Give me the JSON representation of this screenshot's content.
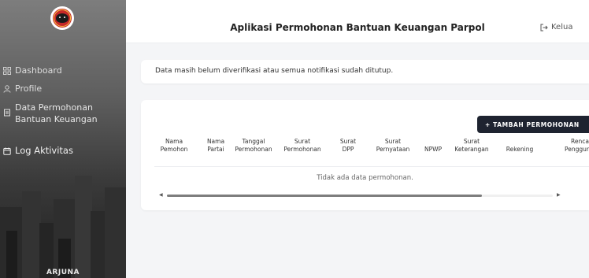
{
  "sidebar": {
    "items": [
      {
        "label": "Dashboard",
        "icon": "grid-icon"
      },
      {
        "label": "Profile",
        "icon": "user-icon"
      },
      {
        "label": "Data Permohonan",
        "label2": "Bantuan Keuangan",
        "icon": "document-icon"
      },
      {
        "label": "Log Aktivitas",
        "icon": "calendar-icon"
      }
    ],
    "footer": "ARJUNA"
  },
  "header": {
    "title": "Aplikasi Permohonan Bantuan Keuangan Parpol",
    "logout_label": "Kelua"
  },
  "notice": "Data masih belum diverifikasi atau semua notifikasi sudah ditutup.",
  "table": {
    "add_button": "+ TAMBAH PERMOHONAN",
    "columns": [
      [
        "Nama",
        "Pemohon"
      ],
      [
        "Nama",
        "Partai"
      ],
      [
        "Tanggal",
        "Permohonan"
      ],
      [
        "Surat",
        "Permohonan"
      ],
      [
        "Surat",
        "DPP"
      ],
      [
        "Surat",
        "Pernyataan"
      ],
      [
        "NPWP"
      ],
      [
        "Surat",
        "Keterangan"
      ],
      [
        "Rekening"
      ],
      [
        "Renca",
        "Penggur"
      ]
    ],
    "empty_message": "Tidak ada data permohonan."
  },
  "colors": {
    "button_bg": "#1e2330",
    "logo_red": "#c62828",
    "scroll_thumb": "#7d7d7d"
  }
}
